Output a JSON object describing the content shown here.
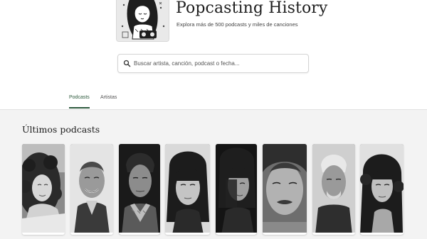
{
  "header": {
    "title": "Popcasting History",
    "subtitle": "Explora más de 500 podcasts y miles de canciones",
    "logo_icon": "illustrated-listener-logo"
  },
  "search": {
    "placeholder": "Buscar artista, canción, podcast o fecha...",
    "value": "",
    "icon": "search-icon"
  },
  "tabs": [
    {
      "label": "Podcasts",
      "active": true
    },
    {
      "label": "Artistas",
      "active": false
    }
  ],
  "section": {
    "title": "Últimos podcasts"
  },
  "cards": [
    {
      "image": "woman-curly-hair-photo"
    },
    {
      "image": "smiling-man-photo"
    },
    {
      "image": "man-portrait-dark-photo"
    },
    {
      "image": "young-woman-bangs-photo"
    },
    {
      "image": "woman-shadowed-face-photo"
    },
    {
      "image": "man-mustache-closeup-photo"
    },
    {
      "image": "older-man-white-hair-photo"
    },
    {
      "image": "woman-long-curly-hair-photo"
    }
  ],
  "colors": {
    "accent": "#2d5a3d",
    "main_background": "#f3f3f3"
  }
}
